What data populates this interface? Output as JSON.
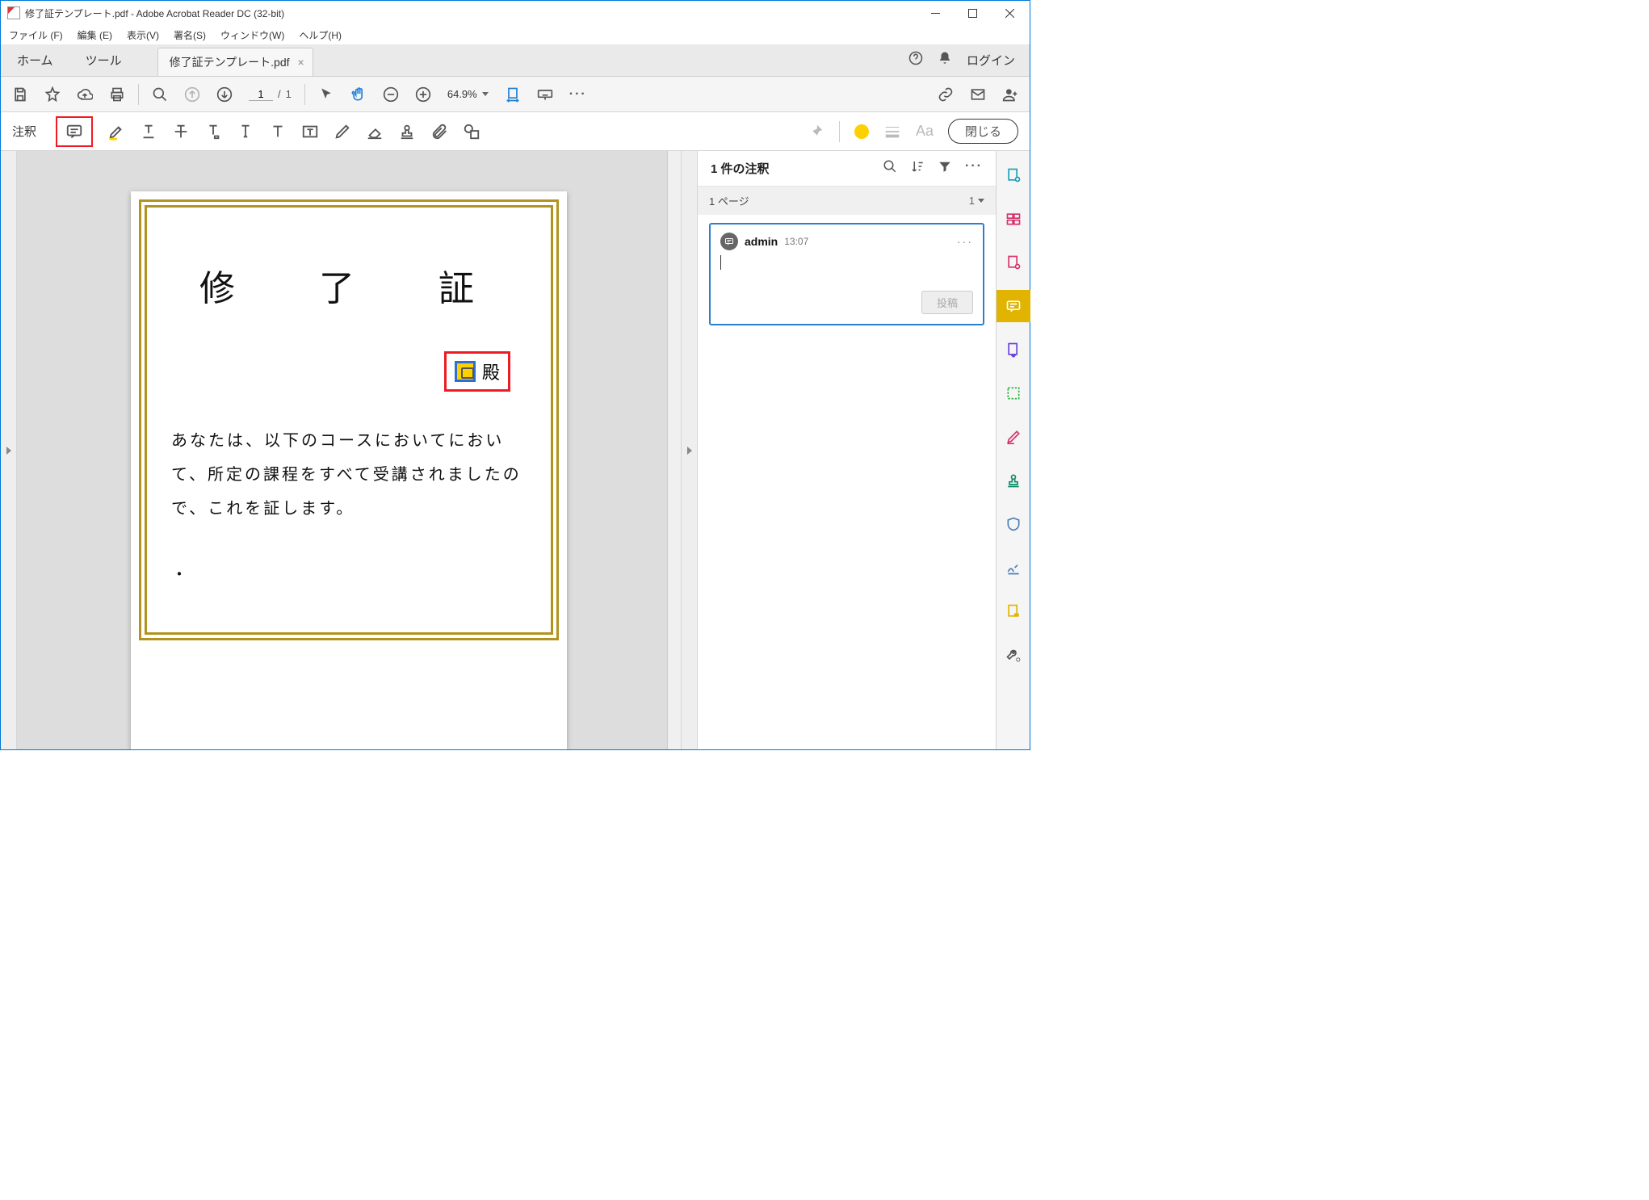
{
  "window": {
    "title": "修了証テンプレート.pdf - Adobe Acrobat Reader DC (32-bit)"
  },
  "menu": {
    "file": "ファイル (F)",
    "edit": "編集 (E)",
    "view": "表示(V)",
    "sign": "署名(S)",
    "window": "ウィンドウ(W)",
    "help": "ヘルプ(H)"
  },
  "tabs": {
    "home": "ホーム",
    "tools": "ツール",
    "doc": "修了証テンプレート.pdf",
    "login": "ログイン"
  },
  "toolbar": {
    "page_current": "1",
    "page_sep": "/",
    "page_total": "1",
    "zoom": "64.9%"
  },
  "anno": {
    "label": "注釈",
    "close": "閉じる",
    "aa": "Aa"
  },
  "comments": {
    "header": "1 件の注釈",
    "page_label": "1 ページ",
    "page_count": "1",
    "item": {
      "author": "admin",
      "time": "13:07",
      "post": "投稿"
    }
  },
  "doc": {
    "title": "修　了　証",
    "honorific": "殿",
    "body": "あなたは、以下のコースにおいてにおいて、所定の課程をすべて受講されましたので、これを証します。",
    "dot": "・"
  }
}
